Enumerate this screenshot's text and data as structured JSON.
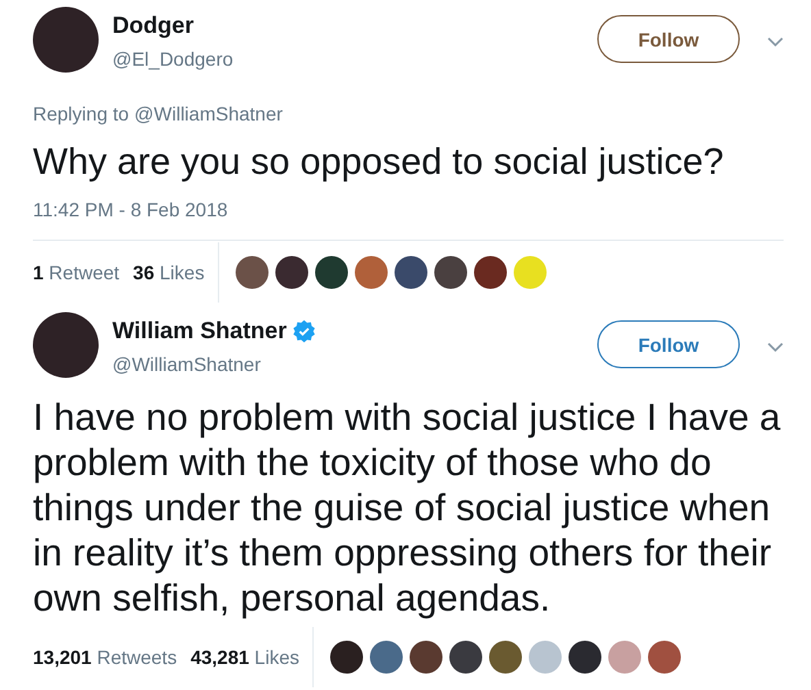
{
  "tweets": [
    {
      "name": "Dodger",
      "verified": false,
      "handle": "@El_Dodgero",
      "follow": {
        "label": "Follow",
        "color": "#7a5a3c"
      },
      "replying_to": {
        "prefix": "Replying to",
        "handle": "@WilliamShatner"
      },
      "text": "Why are you so opposed to social justice?",
      "time": "11:42 PM - 8 Feb 2018",
      "stats": [
        {
          "count": "1",
          "label": "Retweet"
        },
        {
          "count": "36",
          "label": "Likes"
        }
      ],
      "likers": [
        {
          "color": "#6b5148"
        },
        {
          "color": "#3a2a30"
        },
        {
          "color": "#1f3a30"
        },
        {
          "color": "#b0603a"
        },
        {
          "color": "#3a4a6a"
        },
        {
          "color": "#4a4040"
        },
        {
          "color": "#6a2a20"
        },
        {
          "color": "#e8e020"
        }
      ]
    },
    {
      "name": "William Shatner",
      "verified": true,
      "handle": "@WilliamShatner",
      "follow": {
        "label": "Follow",
        "color": "#2b7bb9"
      },
      "text": "I have no problem with social justice I have a problem with the toxicity of those who do things under the guise of social justice when in reality it’s them oppressing others for their own selfish, personal agendas.",
      "stats": [
        {
          "count": "13,201",
          "label": "Retweets"
        },
        {
          "count": "43,281",
          "label": "Likes"
        }
      ],
      "likers": [
        {
          "color": "#2a2020"
        },
        {
          "color": "#4a6a8a"
        },
        {
          "color": "#5a3a30"
        },
        {
          "color": "#3a3a40"
        },
        {
          "color": "#6a5a30"
        },
        {
          "color": "#b8c4d0"
        },
        {
          "color": "#2a2a30"
        },
        {
          "color": "#c8a0a0"
        },
        {
          "color": "#a05040"
        }
      ]
    }
  ]
}
